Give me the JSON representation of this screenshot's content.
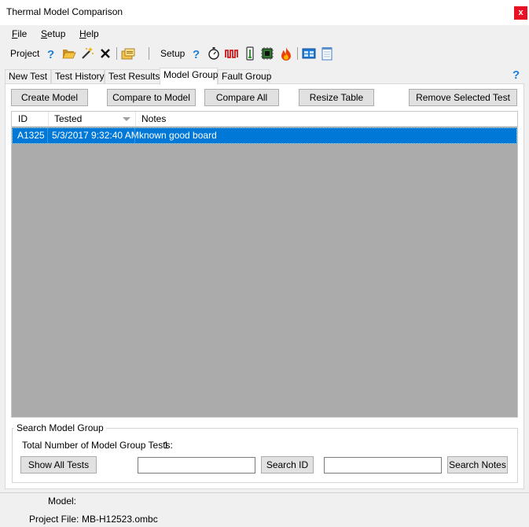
{
  "window": {
    "title": "Thermal Model Comparison",
    "close_glyph": "x"
  },
  "menu": [
    {
      "accel": "F",
      "rest": "ile"
    },
    {
      "accel": "S",
      "rest": "etup"
    },
    {
      "accel": "H",
      "rest": "elp"
    }
  ],
  "toolbar": {
    "project_label": "Project",
    "setup_label": "Setup",
    "project_icons": [
      "help-icon",
      "open-folder-icon",
      "magic-wand-icon",
      "delete-x-icon",
      "project-files-icon"
    ],
    "setup_icons": [
      "help-icon",
      "stopwatch-icon",
      "waveform-icon",
      "thermometer-icon",
      "circuit-board-icon",
      "flame-icon",
      "grid-window-icon",
      "notepad-icon"
    ]
  },
  "tabs": [
    "New Test",
    "Test History",
    "Test Results",
    "Model Group",
    "Fault Group"
  ],
  "active_tab": "Model Group",
  "buttons": {
    "create_model": "Create Model",
    "compare_to_model": "Compare to Model",
    "compare_all": "Compare All",
    "resize_table": "Resize Table",
    "remove_selected": "Remove Selected Test"
  },
  "table": {
    "columns": [
      "ID",
      "Tested",
      "Notes"
    ],
    "sorted_column": "Tested",
    "rows": [
      {
        "id": "A1325",
        "tested": "5/3/2017 9:32:40 AM",
        "notes": "known good board",
        "selected": true
      }
    ]
  },
  "search": {
    "group_title": "Search Model Group",
    "total_label": "Total Number of Model Group Tests:",
    "total_value": "1",
    "show_all": "Show All Tests",
    "search_id_button": "Search ID",
    "search_notes_button": "Search Notes",
    "id_input_value": "",
    "notes_input_value": ""
  },
  "status": {
    "model_label": "Model:",
    "model_value": "",
    "project_file_label": "Project File:",
    "project_file_value": "MB-H12523.ombc"
  },
  "colors": {
    "selection": "#0078d7",
    "close": "#e81123",
    "help_blue": "#1e7fd6",
    "grid_empty": "#ababab"
  }
}
